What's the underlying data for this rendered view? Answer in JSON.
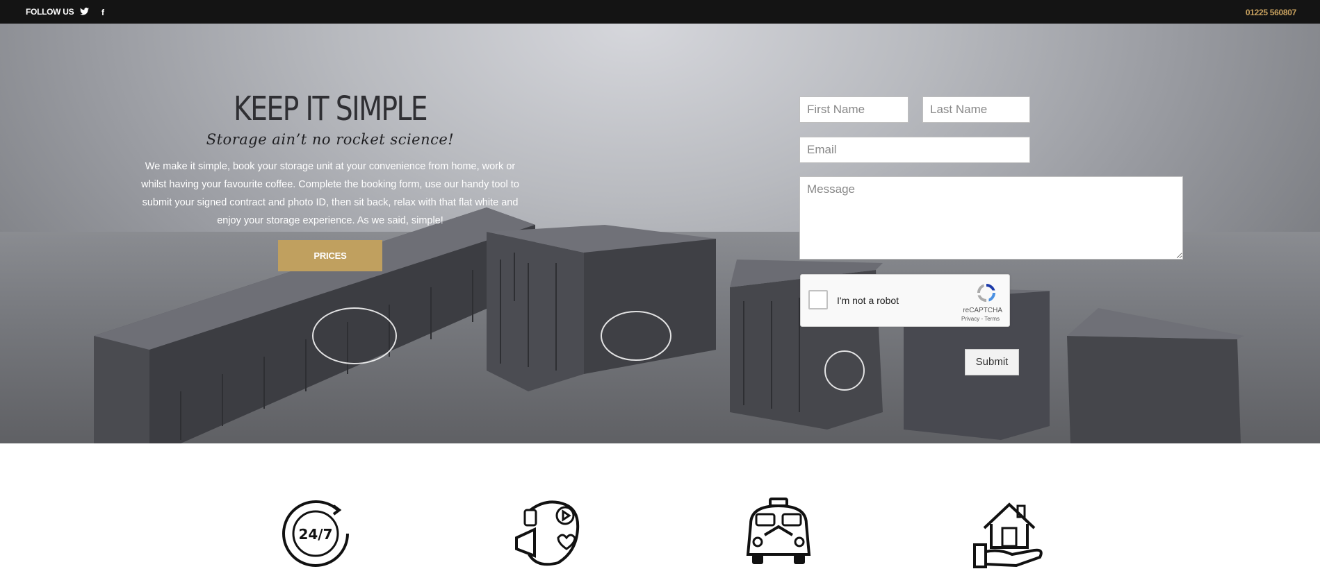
{
  "topbar": {
    "follow_label": "FOLLOW US",
    "twitter_glyph": "🐦",
    "facebook_glyph": "f",
    "phone": "01225 560807"
  },
  "hero": {
    "headline": "KEEP IT SIMPLE",
    "subhead": "Storage ain’t no rocket science!",
    "body": "We make it simple, book your storage unit at your convenience from home, work or whilst having your favourite coffee. Complete the booking form, use our handy tool to submit your signed contract and photo ID, then sit back, relax with that flat white and enjoy your storage experience. As we said, simple!",
    "prices_label": "PRICES"
  },
  "form": {
    "first_name_placeholder": "First Name",
    "last_name_placeholder": "Last Name",
    "email_placeholder": "Email",
    "message_placeholder": "Message",
    "captcha_label": "I'm not a robot",
    "captcha_brand": "reCAPTCHA",
    "captcha_links": "Privacy - Terms",
    "submit_label": "Submit"
  },
  "features": {
    "icons": [
      "24-7-clock-icon",
      "social-megaphone-icon",
      "camper-van-icon",
      "house-in-hand-icon"
    ],
    "clock_text": "24/7"
  },
  "colors": {
    "topbar_bg": "#141414",
    "accent_gold": "#c0a05f",
    "phone_gold": "#c9a25f"
  }
}
